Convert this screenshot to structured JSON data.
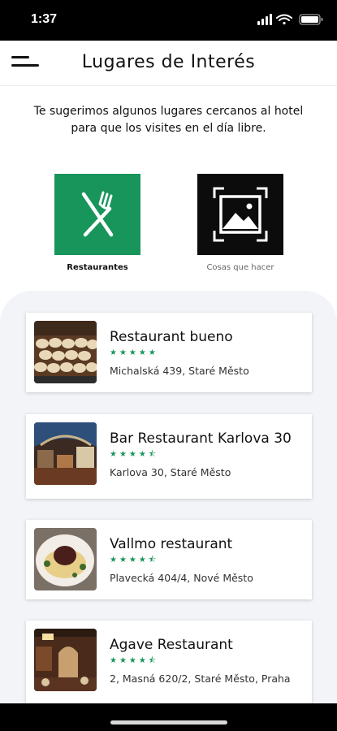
{
  "status_bar": {
    "time": "1:37"
  },
  "header": {
    "title": "Lugares de Interés"
  },
  "intro_text": "Te sugerimos algunos lugares cercanos al hotel para que los visites en el día libre.",
  "categories": [
    {
      "label": "Restaurantes",
      "icon": "fork-knife-icon",
      "color": "#18955a"
    },
    {
      "label": "Cosas que hacer",
      "icon": "image-frame-icon",
      "color": "#0c0c0c"
    }
  ],
  "places": [
    {
      "name": "Restaurant bueno",
      "rating": 5,
      "address": "Michalská 439, Staré Město"
    },
    {
      "name": "Bar Restaurant Karlova 30",
      "rating": 4.5,
      "address": "Karlova 30, Staré Město"
    },
    {
      "name": "Vallmo restaurant",
      "rating": 4.5,
      "address": "Plavecká 404/4, Nové Město"
    },
    {
      "name": "Agave Restaurant",
      "rating": 4.5,
      "address": "2, Masná 620/2, Staré Město, Praha"
    }
  ],
  "colors": {
    "accent": "#18955a",
    "panel_bg": "#f2f4f8"
  }
}
